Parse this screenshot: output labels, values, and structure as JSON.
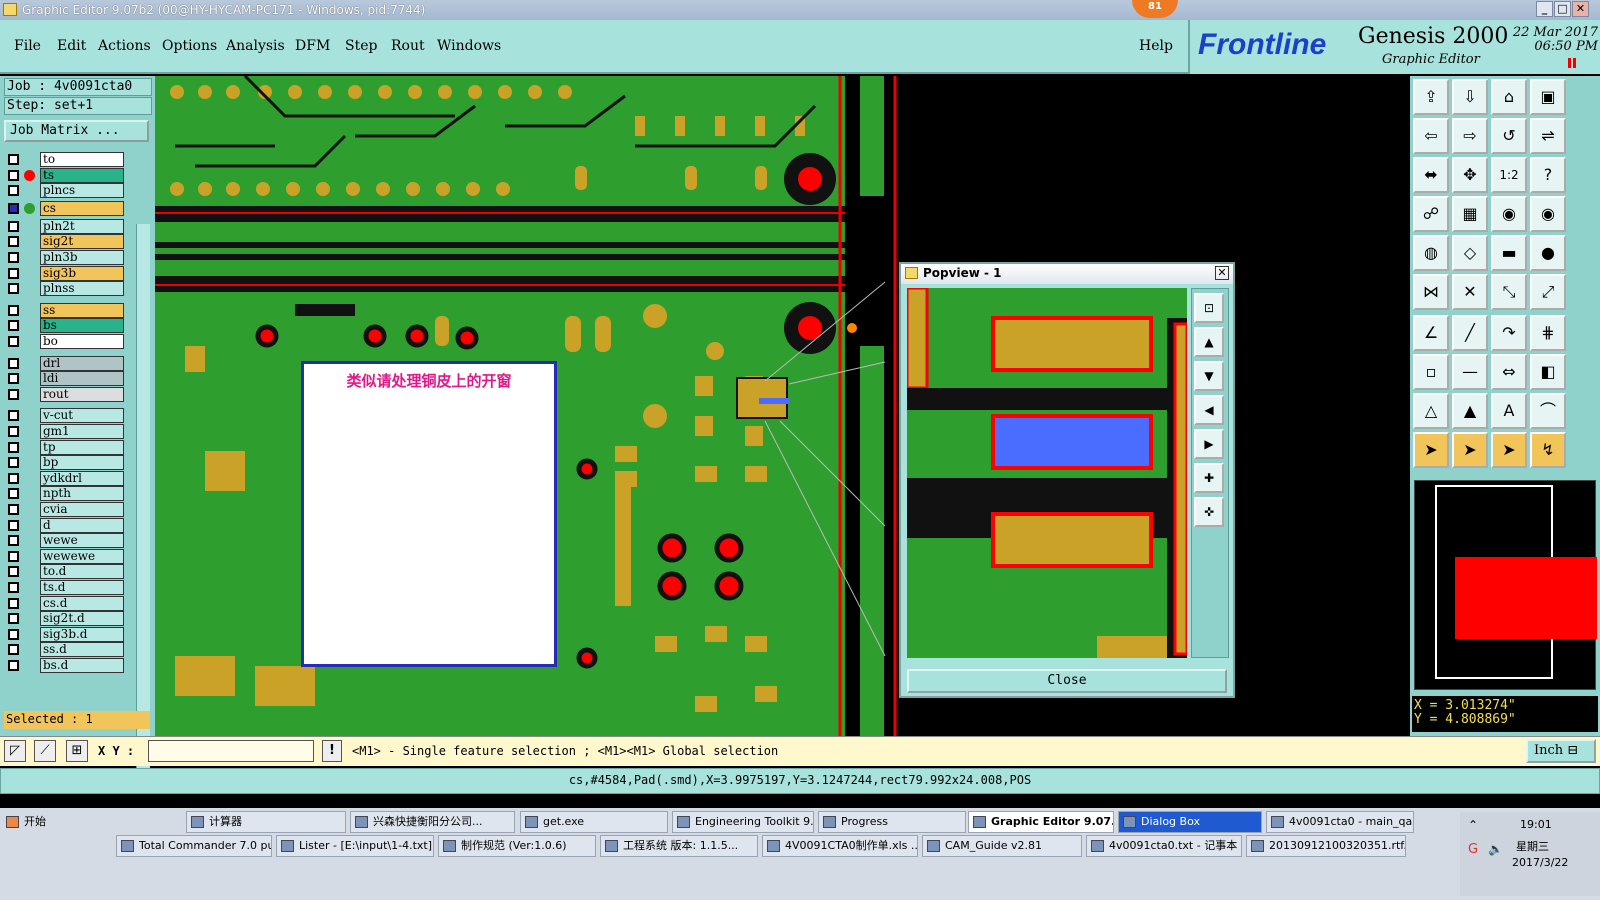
{
  "window": {
    "title": "Graphic Editor 9.07b2 (00@HY-HYCAM-PC171 - Windows, pid:7744)",
    "badge": "81"
  },
  "menu": [
    "File",
    "Edit",
    "Actions",
    "Options",
    "Analysis",
    "DFM",
    "Step",
    "Rout",
    "Windows"
  ],
  "help_label": "Help",
  "logo": {
    "brand": "Frontline",
    "product": "Genesis 2000",
    "sub": "Graphic Editor",
    "date": "22 Mar 2017",
    "time": "06:50 PM"
  },
  "job": {
    "job_label": "Job  : 4v0091cta0",
    "step_label": "Step:  set+1",
    "matrix_button": "Job Matrix ..."
  },
  "layers": [
    {
      "name": "to",
      "color": "#ffffff"
    },
    {
      "name": "ts",
      "color": "#2ab38a",
      "marker": "red"
    },
    {
      "name": "plncs",
      "color": "#b8e8e4"
    },
    {
      "name": "cs",
      "color": "#f2c55a",
      "marker": "edit"
    },
    {
      "name": "pln2t",
      "color": "#b8e8e4"
    },
    {
      "name": "sig2t",
      "color": "#f2c55a"
    },
    {
      "name": "pln3b",
      "color": "#b8e8e4"
    },
    {
      "name": "sig3b",
      "color": "#f2c55a"
    },
    {
      "name": "plnss",
      "color": "#b8e8e4"
    },
    {
      "name": "ss",
      "color": "#f2c55a"
    },
    {
      "name": "bs",
      "color": "#2ab38a"
    },
    {
      "name": "bo",
      "color": "#ffffff"
    },
    {
      "name": "drl",
      "color": "#b0c4c8"
    },
    {
      "name": "ldi",
      "color": "#b0c4c8"
    },
    {
      "name": "rout",
      "color": "#dddddd"
    },
    {
      "name": "v-cut",
      "color": "#b8e8e4"
    },
    {
      "name": "gm1",
      "color": "#b8e8e4"
    },
    {
      "name": "tp",
      "color": "#b8e8e4"
    },
    {
      "name": "bp",
      "color": "#b8e8e4"
    },
    {
      "name": "ydkdrl",
      "color": "#b8e8e4"
    },
    {
      "name": "npth",
      "color": "#b8e8e4"
    },
    {
      "name": "cvia",
      "color": "#b8e8e4"
    },
    {
      "name": "d",
      "color": "#b8e8e4"
    },
    {
      "name": "wewe",
      "color": "#b8e8e4"
    },
    {
      "name": "wewewe",
      "color": "#b8e8e4"
    },
    {
      "name": "to.d",
      "color": "#b8e8e4"
    },
    {
      "name": "ts.d",
      "color": "#b8e8e4"
    },
    {
      "name": "cs.d",
      "color": "#b8e8e4"
    },
    {
      "name": "sig2t.d",
      "color": "#b8e8e4"
    },
    {
      "name": "sig3b.d",
      "color": "#b8e8e4"
    },
    {
      "name": "ss.d",
      "color": "#b8e8e4"
    },
    {
      "name": "bs.d",
      "color": "#b8e8e4"
    }
  ],
  "selected_label": "Selected : 1",
  "note_text": "类似请处理铜皮上的开窗",
  "popview": {
    "title": "Popview - 1",
    "close_label": "Close"
  },
  "coords": {
    "x": "X = 3.013274\"",
    "y": "Y = 4.808869\""
  },
  "bottom": {
    "xy_label": "X Y :",
    "hint": "<M1> - Single feature selection ; <M1><M1> Global selection",
    "unit": "Inch"
  },
  "status_text": "cs,#4584,Pad(.smd),X=3.9975197,Y=3.1247244,rect79.992x24.008,POS",
  "taskbar": {
    "start": "开始",
    "row1": [
      "计算器",
      "兴森快捷衡阳分公司...",
      "get.exe",
      "Engineering Toolkit 9....",
      "Progress",
      "Graphic Editor 9.07...",
      "Dialog Box",
      "4v0091cta0 - main_qa"
    ],
    "row2": [
      "Total Commander 7.0 pu...",
      "Lister - [E:\\input\\1-4.txt]",
      "制作规范 (Ver:1.0.6)",
      "工程系统  版本: 1.1.5...",
      "4V0091CTA0制作单.xls ...",
      "CAM_Guide v2.81",
      "4v0091cta0.txt - 记事本",
      "20130912100320351.rtf..."
    ],
    "clock": "19:01",
    "weekday": "星期三",
    "date": "2017/3/22"
  },
  "colors": {
    "board_green": "#2e9e2e",
    "pad_gold": "#c9a227",
    "trace_black": "#111111",
    "highlight_red": "#ff0000",
    "select_blue": "#4a6cff",
    "panel_teal": "#8fd2cc"
  }
}
